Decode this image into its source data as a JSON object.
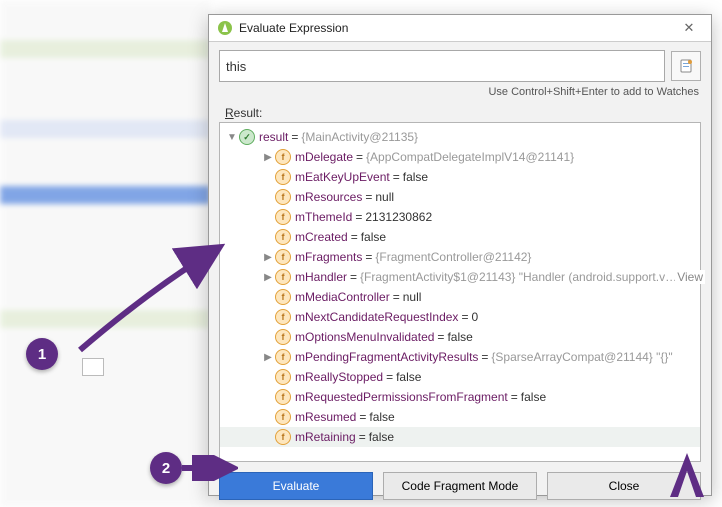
{
  "dialog": {
    "title": "Evaluate Expression",
    "expression": "this",
    "hint": "Use Control+Shift+Enter to add to Watches",
    "result_label": "Result:",
    "buttons": {
      "evaluate": "Evaluate",
      "fragment": "Code Fragment Mode",
      "close": "Close"
    }
  },
  "tree": {
    "root": {
      "name": "result",
      "val": "{MainActivity@21135}"
    },
    "items": [
      {
        "indent": 2,
        "expand": "right",
        "name": "mDelegate",
        "val": "{AppCompatDelegateImplV14@21141}",
        "gray": true
      },
      {
        "indent": 2,
        "expand": "",
        "name": "mEatKeyUpEvent",
        "val": "false"
      },
      {
        "indent": 2,
        "expand": "",
        "name": "mResources",
        "val": "null"
      },
      {
        "indent": 2,
        "expand": "",
        "name": "mThemeId",
        "val": "2131230862"
      },
      {
        "indent": 2,
        "expand": "",
        "name": "mCreated",
        "val": "false"
      },
      {
        "indent": 2,
        "expand": "right",
        "name": "mFragments",
        "val": "{FragmentController@21142}",
        "gray": true
      },
      {
        "indent": 2,
        "expand": "right",
        "name": "mHandler",
        "val": "{FragmentActivity$1@21143} \"Handler (android.support.v…",
        "gray": true,
        "view": "View"
      },
      {
        "indent": 2,
        "expand": "",
        "name": "mMediaController",
        "val": "null"
      },
      {
        "indent": 2,
        "expand": "",
        "name": "mNextCandidateRequestIndex",
        "val": "0"
      },
      {
        "indent": 2,
        "expand": "",
        "name": "mOptionsMenuInvalidated",
        "val": "false"
      },
      {
        "indent": 2,
        "expand": "right",
        "name": "mPendingFragmentActivityResults",
        "val": "{SparseArrayCompat@21144} \"{}\"",
        "gray": true
      },
      {
        "indent": 2,
        "expand": "",
        "name": "mReallyStopped",
        "val": "false"
      },
      {
        "indent": 2,
        "expand": "",
        "name": "mRequestedPermissionsFromFragment",
        "val": "false"
      },
      {
        "indent": 2,
        "expand": "",
        "name": "mResumed",
        "val": "false"
      },
      {
        "indent": 2,
        "expand": "",
        "name": "mRetaining",
        "val": "false",
        "sel": true
      }
    ]
  },
  "annot": {
    "b1": "1",
    "b2": "2"
  }
}
